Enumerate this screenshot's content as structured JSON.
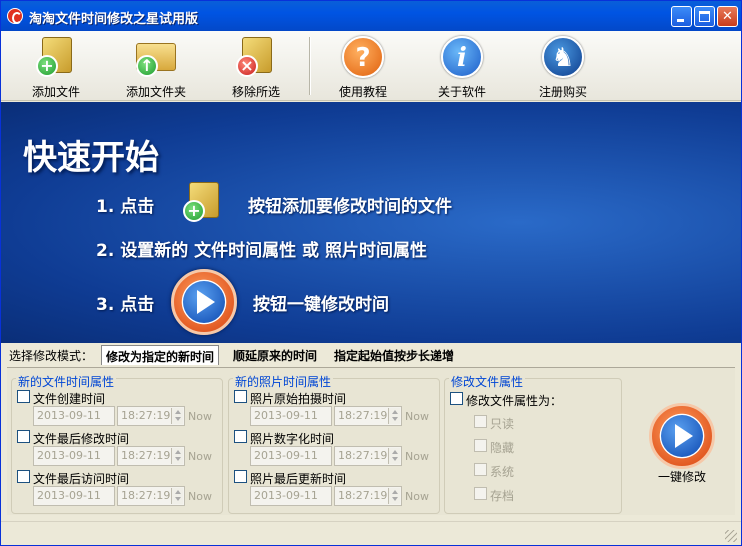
{
  "window": {
    "title": "淘淘文件时间修改之星试用版"
  },
  "toolbar": {
    "add_file": "添加文件",
    "add_folder": "添加文件夹",
    "remove": "移除所选",
    "tutorial": "使用教程",
    "about": "关于软件",
    "buy": "注册购买"
  },
  "banner": {
    "heading": "快速开始",
    "step1_prefix": "1. 点击",
    "step1_suffix": "按钮添加要修改时间的文件",
    "step2": "2. 设置新的 文件时间属性 或 照片时间属性",
    "step3_prefix": "3. 点击",
    "step3_suffix": "按钮一键修改时间"
  },
  "mode": {
    "label": "选择修改模式：",
    "tabs": [
      "修改为指定的新时间",
      "顺延原来的时间",
      "指定起始值按步长递增"
    ]
  },
  "file_group": {
    "title": "新的文件时间属性",
    "rows": [
      {
        "label": "文件创建时间",
        "date": "2013-09-11",
        "time": "18:27:19",
        "now": "Now"
      },
      {
        "label": "文件最后修改时间",
        "date": "2013-09-11",
        "time": "18:27:19",
        "now": "Now"
      },
      {
        "label": "文件最后访问时间",
        "date": "2013-09-11",
        "time": "18:27:19",
        "now": "Now"
      }
    ]
  },
  "photo_group": {
    "title": "新的照片时间属性",
    "rows": [
      {
        "label": "照片原始拍摄时间",
        "date": "2013-09-11",
        "time": "18:27:19",
        "now": "Now"
      },
      {
        "label": "照片数字化时间",
        "date": "2013-09-11",
        "time": "18:27:19",
        "now": "Now"
      },
      {
        "label": "照片最后更新时间",
        "date": "2013-09-11",
        "time": "18:27:19",
        "now": "Now"
      }
    ]
  },
  "attr_group": {
    "title": "修改文件属性",
    "main_label": "修改文件属性为：",
    "options": [
      "只读",
      "隐藏",
      "系统",
      "存档"
    ]
  },
  "one_click": {
    "label": "一键修改"
  }
}
